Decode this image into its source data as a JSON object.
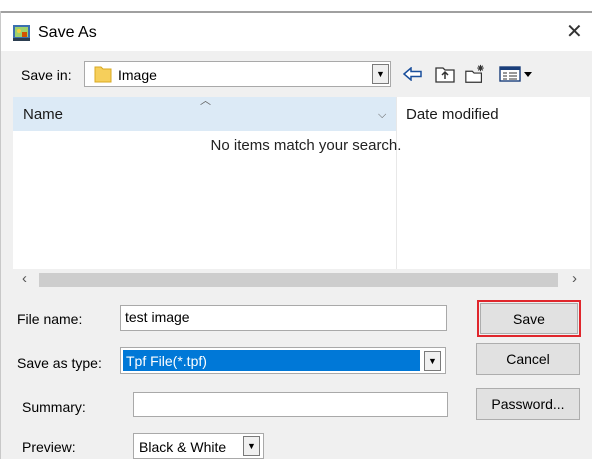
{
  "window": {
    "title": "Save As",
    "close_icon": "close-icon",
    "app_icon": "app-icon"
  },
  "save_in": {
    "label": "Save in:",
    "value": "Image",
    "folder_icon": "folder-icon"
  },
  "toolbar": {
    "icons": [
      "back-arrow-icon",
      "up-folder-icon",
      "new-folder-icon",
      "view-menu-icon"
    ]
  },
  "file_list": {
    "columns": [
      "Name",
      "Date modified"
    ],
    "empty_message": "No items match your search."
  },
  "form": {
    "file_name_label": "File name:",
    "file_name_value": "test image",
    "save_as_type_label": "Save as type:",
    "save_as_type_value": "Tpf File(*.tpf)",
    "summary_label": "Summary:",
    "summary_value": "",
    "preview_label": "Preview:",
    "preview_value": "Black & White"
  },
  "buttons": {
    "save": "Save",
    "cancel": "Cancel",
    "password": "Password..."
  },
  "colors": {
    "highlight_border": "#e0262c",
    "header_background": "#dceaf6",
    "selection": "#0078d7"
  }
}
